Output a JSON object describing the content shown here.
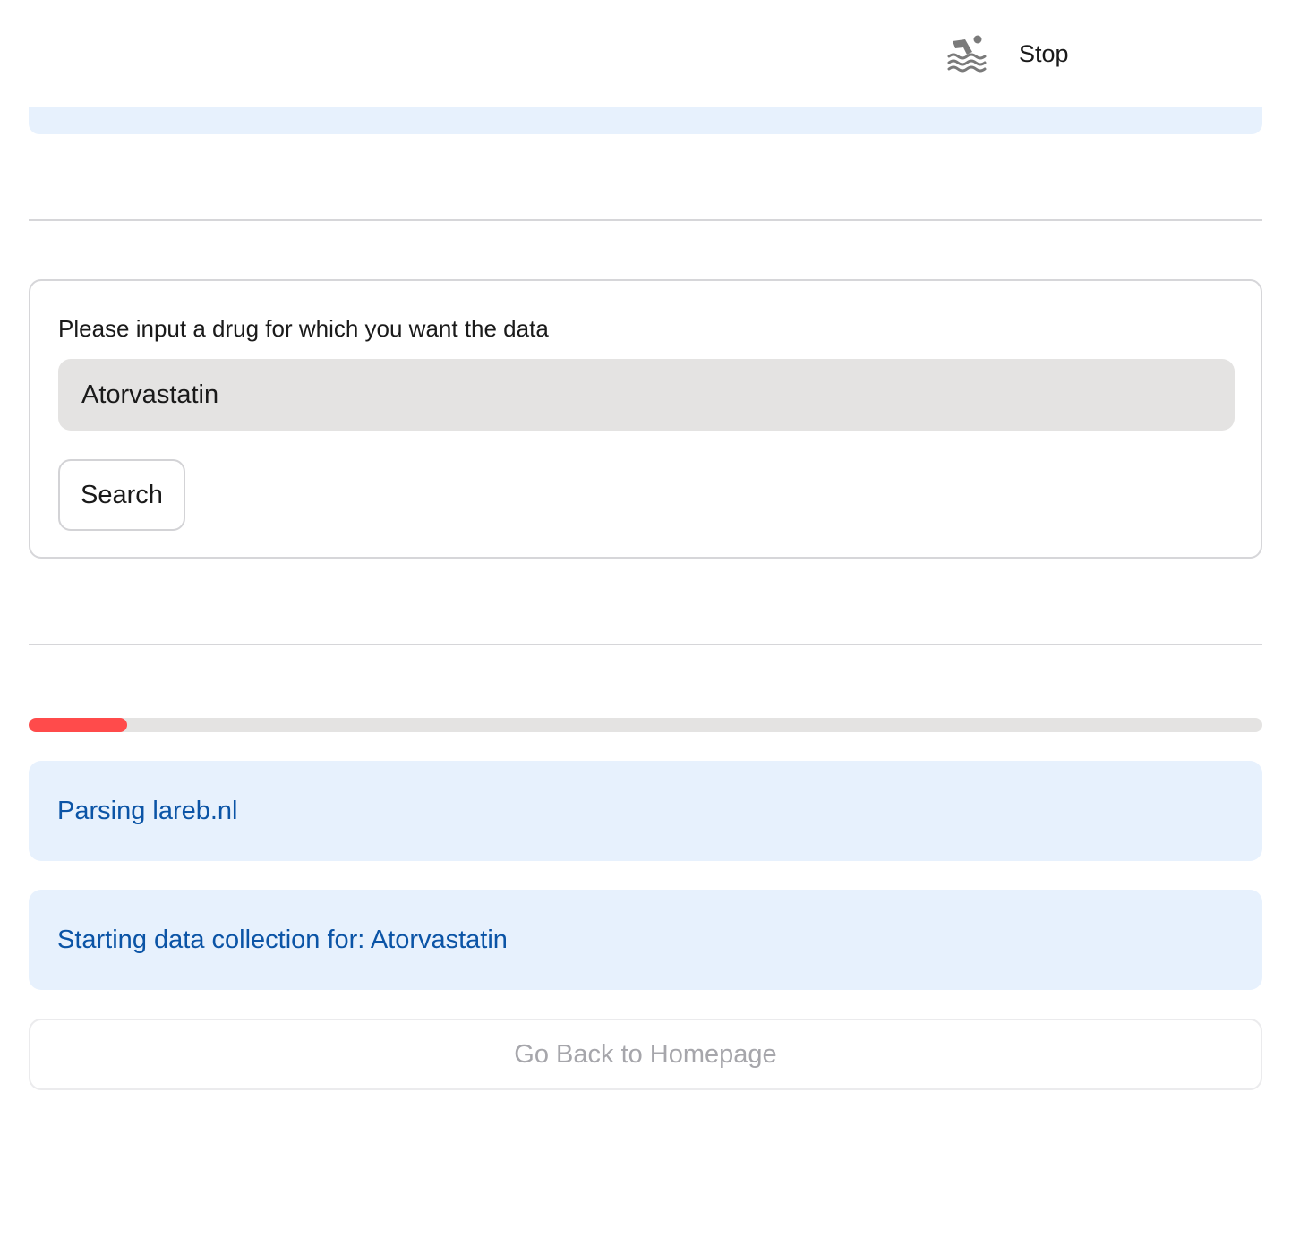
{
  "header": {
    "status_label": "Stop",
    "status_icon": "swimmer-icon"
  },
  "form": {
    "label": "Please input a drug for which you want the data",
    "input_value": "Atorvastatin",
    "submit_label": "Search"
  },
  "progress": {
    "fraction": 0.08,
    "color": "#ff4b4b"
  },
  "alerts": [
    {
      "text": "Parsing lareb.nl"
    },
    {
      "text": "Starting data collection for: Atorvastatin"
    }
  ],
  "footer": {
    "home_button_label": "Go Back to Homepage"
  },
  "colors": {
    "info_background": "#e7f1fd",
    "info_text": "#0b54a6",
    "accent": "#ff4b4b"
  }
}
